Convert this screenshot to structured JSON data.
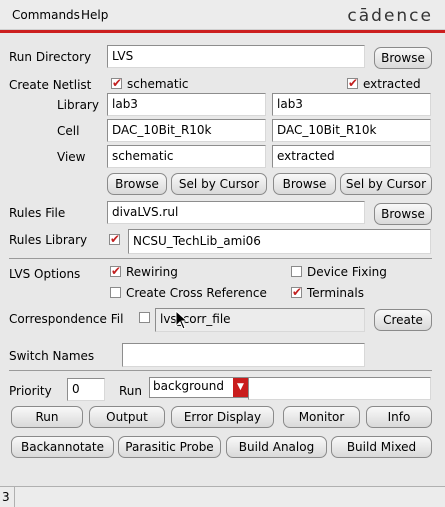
{
  "menubar": {
    "commands": "Commands",
    "help": "Help",
    "logo": "cādence"
  },
  "run_directory": {
    "label": "Run Directory",
    "value": "LVS",
    "browse": "Browse"
  },
  "create_netlist": {
    "label": "Create Netlist",
    "schematic_label": "schematic",
    "schematic_checked": true,
    "extracted_label": "extracted",
    "extracted_checked": true,
    "library_label": "Library",
    "library_left": "lab3",
    "library_right": "lab3",
    "cell_label": "Cell",
    "cell_left": "DAC_10Bit_R10k",
    "cell_right": "DAC_10Bit_R10k",
    "view_label": "View",
    "view_left": "schematic",
    "view_right": "extracted",
    "browse": "Browse",
    "sel_by_cursor": "Sel by Cursor"
  },
  "rules_file": {
    "label": "Rules File",
    "value": "divaLVS.rul",
    "browse": "Browse"
  },
  "rules_library": {
    "label": "Rules Library",
    "checked": true,
    "value": "NCSU_TechLib_ami06"
  },
  "lvs_options": {
    "label": "LVS Options",
    "rewiring": "Rewiring",
    "rewiring_checked": true,
    "device_fixing": "Device Fixing",
    "device_fixing_checked": false,
    "cross_reference": "Create Cross Reference",
    "cross_reference_checked": false,
    "terminals": "Terminals",
    "terminals_checked": true
  },
  "correspondence": {
    "label": "Correspondence Fil",
    "checked": false,
    "value": "lvs_corr_file",
    "create": "Create"
  },
  "switch_names": {
    "label": "Switch Names",
    "value": ""
  },
  "priority": {
    "label": "Priority",
    "value": "0",
    "run_label": "Run",
    "run_mode": "background"
  },
  "buttons_row1": {
    "run": "Run",
    "output": "Output",
    "error_display": "Error Display",
    "monitor": "Monitor",
    "info": "Info"
  },
  "buttons_row2": {
    "backannotate": "Backannotate",
    "parasitic_probe": "Parasitic Probe",
    "build_analog": "Build Analog",
    "build_mixed": "Build Mixed"
  },
  "status_bar": {
    "text": "3"
  }
}
